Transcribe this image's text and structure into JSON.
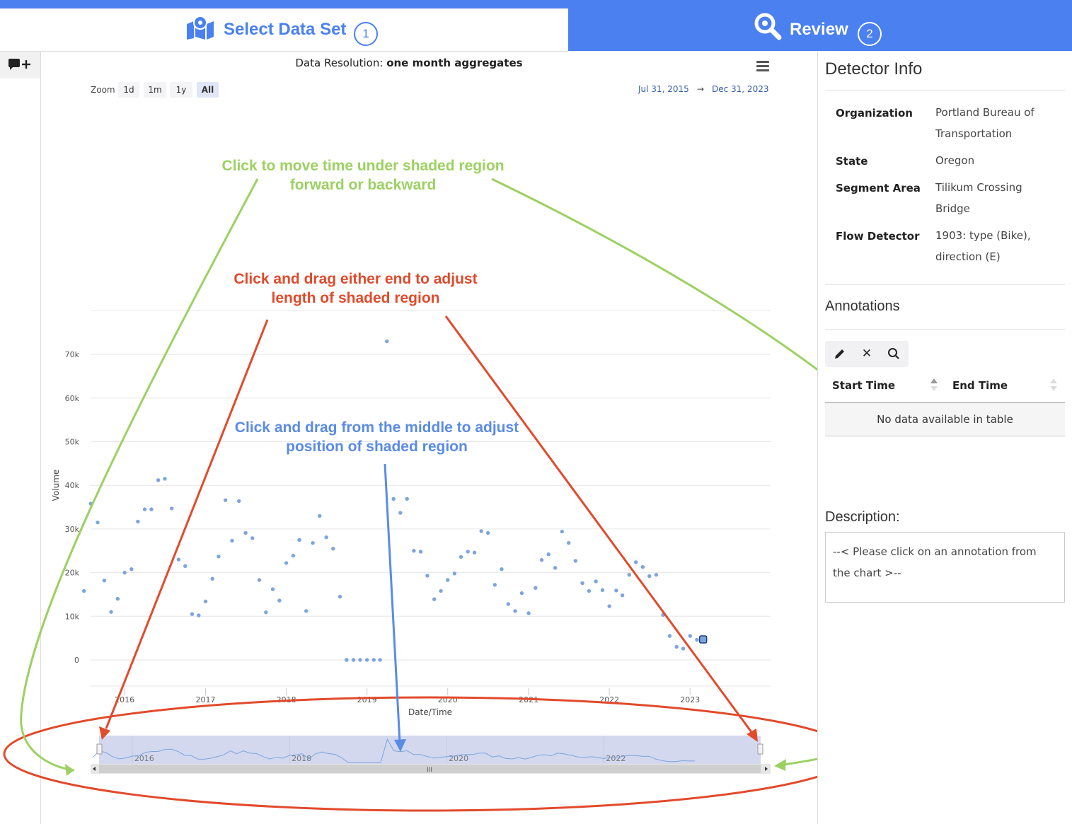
{
  "stepper": {
    "step1": {
      "label": "Select Data Set",
      "number": "1",
      "icon": "map-pin-icon"
    },
    "step2": {
      "label": "Review",
      "number": "2",
      "icon": "search-icon"
    }
  },
  "toolbar": {
    "add_comment_icon": "add-comment-icon"
  },
  "chart": {
    "resolution_prefix": "Data Resolution:",
    "resolution_value": "one month aggregates",
    "menu_icon": "hamburger-menu-icon",
    "zoom_label": "Zoom",
    "zoom_buttons": [
      "1d",
      "1m",
      "1y",
      "All"
    ],
    "active_zoom": "All",
    "range_from": "Jul 31, 2015",
    "range_arrow": "→",
    "range_to": "Dec 31, 2023"
  },
  "chart_data": {
    "type": "scatter",
    "title": "",
    "xlabel": "Date/Time",
    "ylabel": "Volume",
    "ylim": [
      -6000,
      80000
    ],
    "y_ticks": [
      "0",
      "10k",
      "20k",
      "30k",
      "40k",
      "50k",
      "60k",
      "70k"
    ],
    "x_ticks": [
      "2016",
      "2017",
      "2018",
      "2019",
      "2020",
      "2021",
      "2022",
      "2023"
    ],
    "x_range": [
      "2015-07-31",
      "2023-12-31"
    ],
    "grid": true,
    "point_color": "#7ca5dc",
    "series": [
      {
        "x": [
          "2015-07",
          "2015-08",
          "2015-09",
          "2015-10",
          "2015-11",
          "2015-12",
          "2016-01",
          "2016-02",
          "2016-03",
          "2016-04",
          "2016-05",
          "2016-06",
          "2016-07",
          "2016-08",
          "2016-09",
          "2016-10",
          "2016-11",
          "2016-12",
          "2017-01",
          "2017-02",
          "2017-03",
          "2017-04",
          "2017-05",
          "2017-06",
          "2017-07",
          "2017-08",
          "2017-09",
          "2017-10",
          "2017-11",
          "2017-12",
          "2018-01",
          "2018-02",
          "2018-03",
          "2018-04",
          "2018-05",
          "2018-06",
          "2018-07",
          "2018-08",
          "2018-09",
          "2018-10",
          "2018-11",
          "2018-12",
          "2019-01",
          "2019-02",
          "2019-03",
          "2019-04",
          "2019-05",
          "2019-06",
          "2019-07",
          "2019-08",
          "2019-09",
          "2019-10",
          "2019-11",
          "2019-12",
          "2020-01",
          "2020-02",
          "2020-03",
          "2020-04",
          "2020-05",
          "2020-06",
          "2020-07",
          "2020-08",
          "2020-09",
          "2020-10",
          "2020-11",
          "2020-12",
          "2021-01",
          "2021-02",
          "2021-03",
          "2021-04",
          "2021-05",
          "2021-06",
          "2021-07",
          "2021-08",
          "2021-09",
          "2021-10",
          "2021-11",
          "2021-12",
          "2022-01",
          "2022-02",
          "2022-03",
          "2022-04",
          "2022-05",
          "2022-06",
          "2022-07",
          "2022-08",
          "2022-09",
          "2022-10",
          "2022-11",
          "2022-12",
          "2023-01",
          "2023-02",
          "2023-03"
        ],
        "y": [
          15800,
          35800,
          31500,
          18200,
          11000,
          14000,
          20000,
          20800,
          31700,
          34500,
          34500,
          41200,
          41500,
          34700,
          23000,
          21500,
          10500,
          10200,
          13400,
          18600,
          23700,
          36600,
          27300,
          36400,
          29100,
          27900,
          18300,
          10900,
          16200,
          13600,
          22200,
          23900,
          27500,
          11200,
          26800,
          33000,
          28100,
          25500,
          14500,
          0,
          0,
          0,
          0,
          0,
          0,
          73000,
          36900,
          33700,
          36900,
          25000,
          24800,
          19300,
          13900,
          15800,
          18300,
          19800,
          23600,
          24800,
          24600,
          29500,
          29100,
          17200,
          20800,
          12800,
          11200,
          15300,
          10700,
          16500,
          22900,
          24200,
          21100,
          29400,
          26800,
          22700,
          17600,
          15800,
          18000,
          16000,
          12300,
          15900,
          14800,
          19500,
          22400,
          21300,
          19200,
          19500,
          10300,
          5500,
          3000,
          2600,
          5500,
          4600,
          4700
        ]
      }
    ],
    "navigator_ticks": [
      "2016",
      "2018",
      "2020",
      "2022"
    ]
  },
  "annotations_overlay": {
    "green": "Click to move time under shaded region forward or backward",
    "red": "Click and drag either end to adjust length of shaded region",
    "blue": "Click and drag from the middle to adjust position of shaded region",
    "colors": {
      "green": "#9cd162",
      "red": "#e24a2b",
      "blue": "#5a8be6"
    }
  },
  "detector": {
    "heading": "Detector Info",
    "rows": [
      {
        "key": "Organization",
        "value": [
          "Portland Bureau of",
          "Transportation"
        ]
      },
      {
        "key": "State",
        "value": [
          "Oregon"
        ]
      },
      {
        "key": "Segment Area",
        "value": [
          "Tilikum Crossing",
          "Bridge"
        ]
      },
      {
        "key": "Flow Detector",
        "value": [
          "1903: type (Bike),",
          "direction (E)"
        ]
      }
    ]
  },
  "annotations_panel": {
    "heading": "Annotations",
    "tools": [
      "edit-icon",
      "delete-icon",
      "zoom-icon"
    ],
    "columns": [
      "Start Time",
      "End Time"
    ],
    "empty": "No data available in table"
  },
  "description": {
    "heading": "Description:",
    "placeholder": "--< Please click on an annotation from the chart >--"
  },
  "colors": {
    "accent": "#4a80f0",
    "marker": "#7ca5dc"
  }
}
